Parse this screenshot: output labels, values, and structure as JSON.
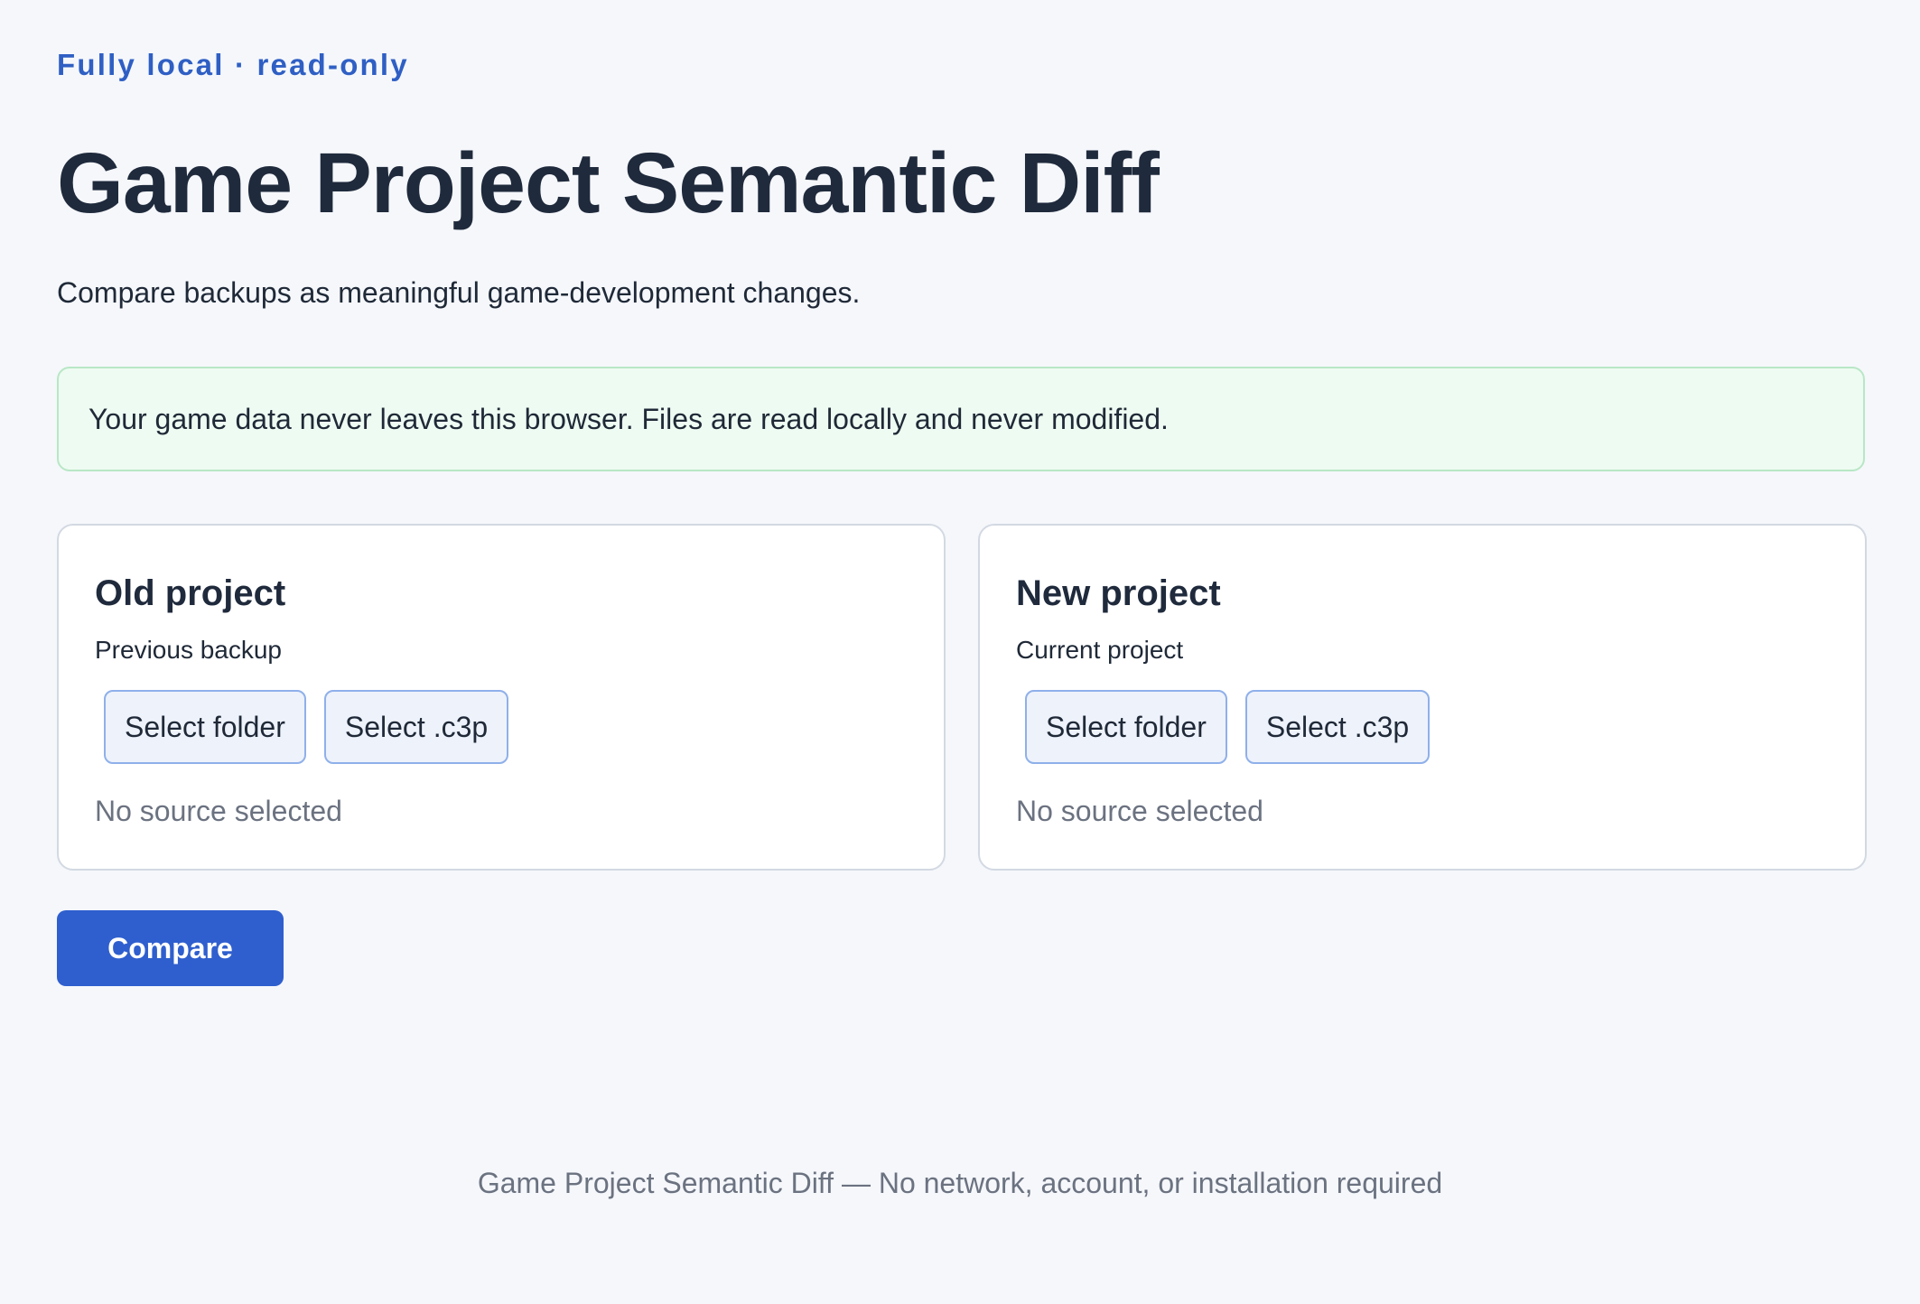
{
  "header": {
    "eyebrow": "Fully local · read-only",
    "title": "Game Project Semantic Diff",
    "subtitle": "Compare backups as meaningful game-development changes."
  },
  "notice": {
    "text": "Your game data never leaves this browser. Files are read locally and never modified."
  },
  "old_project": {
    "title": "Old project",
    "subtitle": "Previous backup",
    "select_folder_label": "Select folder",
    "select_c3p_label": "Select .c3p",
    "status": "No source selected"
  },
  "new_project": {
    "title": "New project",
    "subtitle": "Current project",
    "select_folder_label": "Select folder",
    "select_c3p_label": "Select .c3p",
    "status": "No source selected"
  },
  "actions": {
    "compare_label": "Compare"
  },
  "footer": {
    "text": "Game Project Semantic Diff — No network, account, or installation required"
  },
  "colors": {
    "accent": "#2f5fce",
    "background": "#f5f7fb",
    "notice_bg": "#eefbf2",
    "notice_border": "#b8e7c6"
  }
}
